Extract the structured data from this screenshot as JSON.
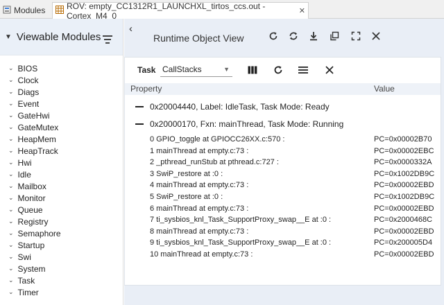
{
  "tabs": {
    "modules_label": "Modules",
    "rov_label": "ROV: empty_CC1312R1_LAUNCHXL_tirtos_ccs.out - Cortex_M4_0"
  },
  "left_panel": {
    "title": "Viewable Modules",
    "modules": [
      "BIOS",
      "Clock",
      "Diags",
      "Event",
      "GateHwi",
      "GateMutex",
      "HeapMem",
      "HeapTrack",
      "Hwi",
      "Idle",
      "Mailbox",
      "Monitor",
      "Queue",
      "Registry",
      "Semaphore",
      "Startup",
      "Swi",
      "System",
      "Task",
      "Timer"
    ]
  },
  "rov": {
    "title": "Runtime Object View"
  },
  "view": {
    "task_label": "Task",
    "selected_view": "CallStacks",
    "col_property": "Property",
    "col_value": "Value",
    "groups": [
      {
        "label": "0x20004440, Label: IdleTask, Task Mode: Ready"
      },
      {
        "label": "0x20000170, Fxn: mainThread, Task Mode: Running"
      }
    ],
    "frames": [
      {
        "text": "0 GPIO_toggle at GPIOCC26XX.c:570 :",
        "value": "PC=0x00002B70"
      },
      {
        "text": "1 mainThread at empty.c:73 :",
        "value": "PC=0x00002EBC"
      },
      {
        "text": "2 _pthread_runStub at pthread.c:727 :",
        "value": "PC=0x0000332A"
      },
      {
        "text": "3 SwiP_restore at :0 :",
        "value": "PC=0x1002DB9C"
      },
      {
        "text": "4 mainThread at empty.c:73 :",
        "value": "PC=0x00002EBD"
      },
      {
        "text": "5 SwiP_restore at :0 :",
        "value": "PC=0x1002DB9C"
      },
      {
        "text": "6 mainThread at empty.c:73 :",
        "value": "PC=0x00002EBD"
      },
      {
        "text": "7 ti_sysbios_knl_Task_SupportProxy_swap__E at :0 :",
        "value": "PC=0x2000468C"
      },
      {
        "text": "8 mainThread at empty.c:73 :",
        "value": "PC=0x00002EBD"
      },
      {
        "text": "9 ti_sysbios_knl_Task_SupportProxy_swap__E at :0 :",
        "value": "PC=0x200005D4"
      },
      {
        "text": "10 mainThread at empty.c:73 :",
        "value": "PC=0x00002EBD"
      }
    ]
  },
  "colors": {
    "panel_bg": "#e9eef6",
    "left_header_bg": "#eaf0f8",
    "table_header_bg": "#eef2f8"
  }
}
